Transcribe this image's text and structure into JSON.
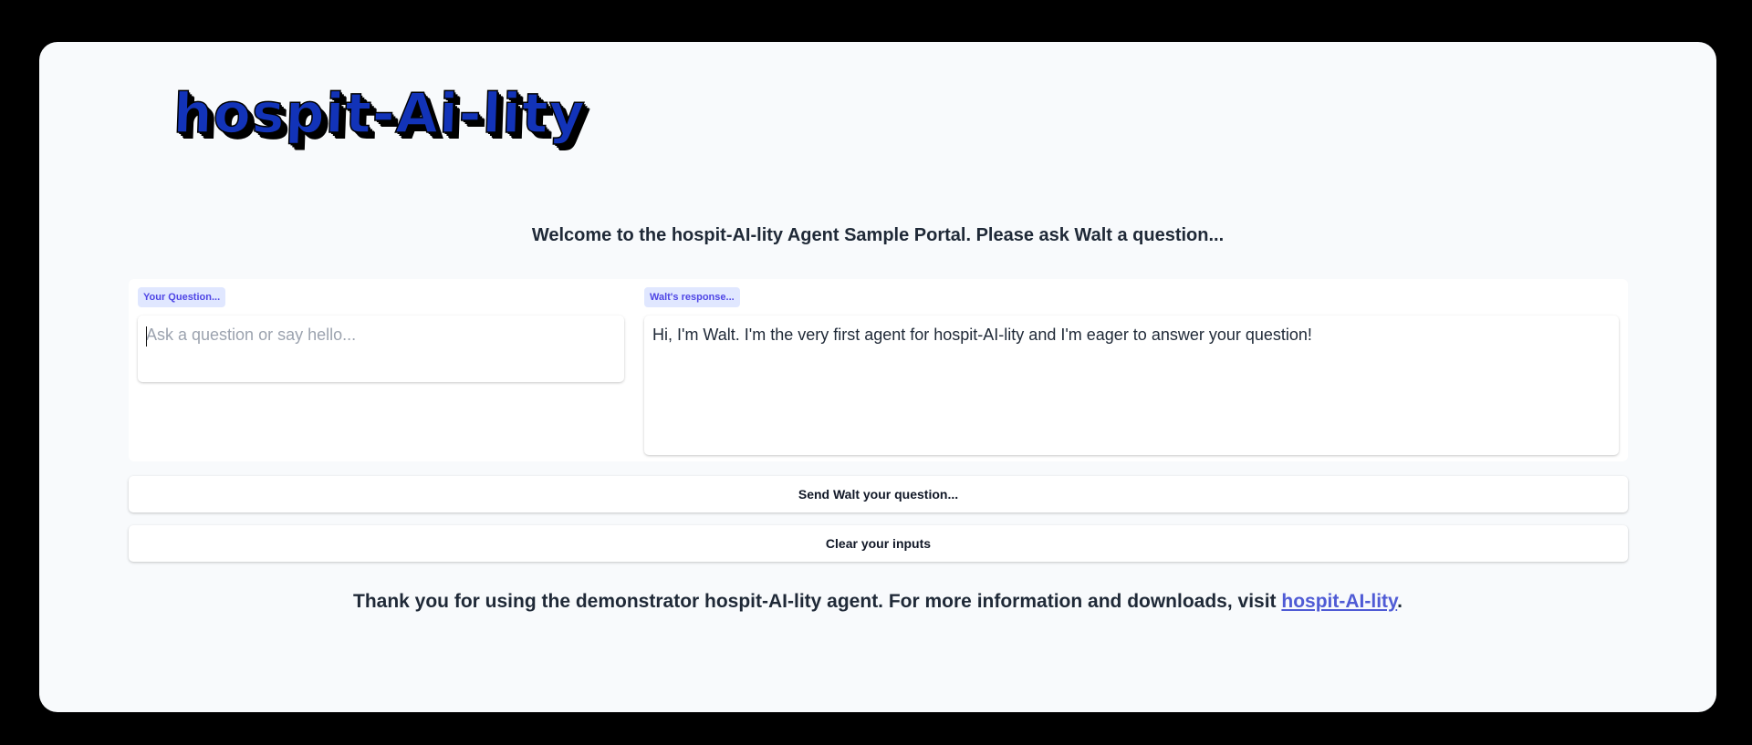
{
  "header": {
    "logo_text": "hospit-Ai-lity"
  },
  "welcome": {
    "text": "Welcome to the hospit-AI-lity Agent Sample Portal. Please ask Walt a question..."
  },
  "question": {
    "label": "Your Question...",
    "placeholder": "Ask a question or say hello...",
    "value": ""
  },
  "response": {
    "label": "Walt's response...",
    "text": "Hi, I'm Walt. I'm the very first agent for hospit-AI-lity and I'm eager to answer your question!"
  },
  "buttons": {
    "send_label": "Send Walt your question...",
    "clear_label": "Clear your inputs"
  },
  "footer": {
    "text": "Thank you for using the demonstrator hospit-AI-lity agent. For more information and downloads, visit ",
    "link_text": "hospit-AI-lity",
    "suffix": "."
  },
  "colors": {
    "logo_blue": "#1233b8",
    "chip_bg": "#e0e7ff",
    "chip_text": "#4f46e5",
    "link": "#4f5bd5",
    "page_bg": "#f8fafc"
  }
}
